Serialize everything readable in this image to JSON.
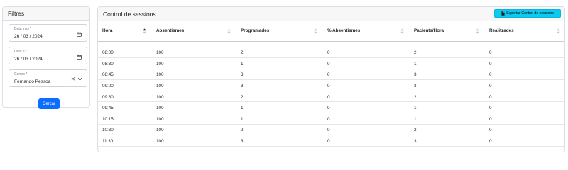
{
  "filters": {
    "title": "Filtres",
    "start_date": {
      "label": "Data inici *",
      "value": "26 / 03 / 2024"
    },
    "end_date": {
      "label": "Data fi *",
      "value": "26 / 03 / 2024"
    },
    "centre": {
      "label": "Centre *",
      "value": "Fernando Pessoa"
    },
    "search_label": "Cercar"
  },
  "main": {
    "title": "Control de sessions",
    "export_label": "Exportar Control de sessions"
  },
  "table": {
    "columns": [
      "Hora",
      "Absentismes",
      "Programades",
      "% Absentismes",
      "Pacients/Hora",
      "Realitzades"
    ],
    "rows": [
      [
        "08:00",
        "100",
        "2",
        "0",
        "2",
        "0"
      ],
      [
        "08:30",
        "100",
        "1",
        "0",
        "1",
        "0"
      ],
      [
        "08:45",
        "100",
        "3",
        "0",
        "3",
        "0"
      ],
      [
        "09:00",
        "100",
        "3",
        "0",
        "3",
        "0"
      ],
      [
        "09:30",
        "100",
        "2",
        "0",
        "2",
        "0"
      ],
      [
        "09:45",
        "100",
        "1",
        "0",
        "1",
        "0"
      ],
      [
        "10:15",
        "100",
        "1",
        "0",
        "1",
        "0"
      ],
      [
        "10:30",
        "100",
        "2",
        "0",
        "2",
        "0"
      ],
      [
        "11:30",
        "100",
        "3",
        "0",
        "3",
        "0"
      ]
    ]
  },
  "colors": {
    "primary": "#0d6efd",
    "info": "#0dcaf0"
  }
}
